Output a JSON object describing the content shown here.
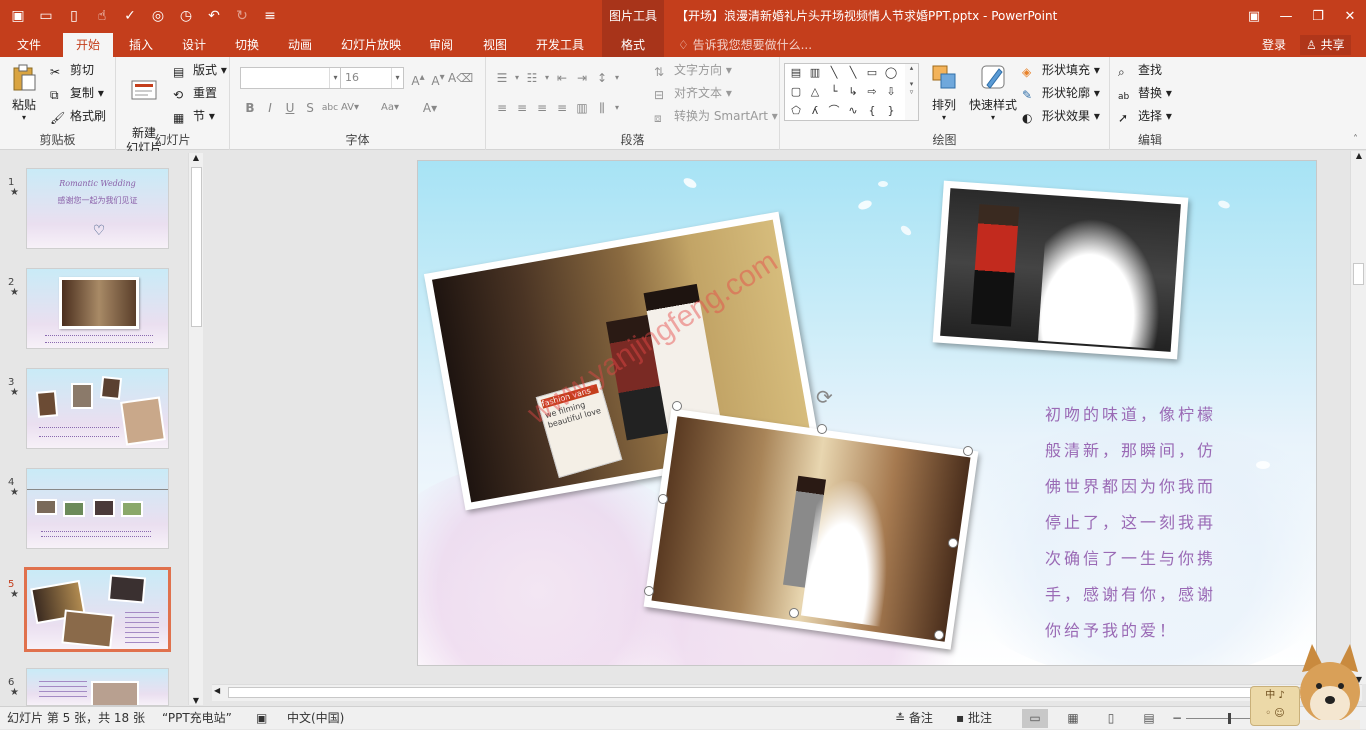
{
  "title_bar": {
    "context_group": "图片工具",
    "document_title": "【开场】浪漫清新婚礼片头开场视频情人节求婚PPT.pptx - PowerPoint"
  },
  "tabs": [
    {
      "label": "文件"
    },
    {
      "label": "开始"
    },
    {
      "label": "插入"
    },
    {
      "label": "设计"
    },
    {
      "label": "切换"
    },
    {
      "label": "动画"
    },
    {
      "label": "幻灯片放映"
    },
    {
      "label": "审阅"
    },
    {
      "label": "视图"
    },
    {
      "label": "开发工具"
    },
    {
      "label": "格式"
    }
  ],
  "tell_me": "告诉我您想要做什么...",
  "account": {
    "login": "登录",
    "share": "共享"
  },
  "ribbon": {
    "clipboard": {
      "label": "剪贴板",
      "paste": "粘贴",
      "cut": "剪切",
      "copy": "复制",
      "format_painter": "格式刷"
    },
    "slides": {
      "label": "幻灯片",
      "new_slide": "新建\n幻灯片",
      "layout": "版式",
      "reset": "重置",
      "section": "节"
    },
    "font": {
      "label": "字体",
      "size": "16"
    },
    "paragraph": {
      "label": "段落",
      "text_direction": "文字方向",
      "align_text": "对齐文本",
      "smartart": "转换为 SmartArt"
    },
    "drawing": {
      "label": "绘图",
      "arrange": "排列",
      "quick_styles": "快速样式",
      "shape_fill": "形状填充",
      "shape_outline": "形状轮廓",
      "shape_effects": "形状效果"
    },
    "editing": {
      "label": "编辑",
      "find": "查找",
      "replace": "替换",
      "select": "选择"
    }
  },
  "thumbnails": [
    {
      "num": "1",
      "title": "Romantic Wedding",
      "text": "感谢您一起为我们见证"
    },
    {
      "num": "2"
    },
    {
      "num": "3"
    },
    {
      "num": "4"
    },
    {
      "num": "5",
      "selected": true
    },
    {
      "num": "6"
    }
  ],
  "slide": {
    "poem": "初吻的味道，像柠檬般清新，那瞬间，仿佛世界都因为你我而停止了，这一刻我再次确信了一生与你携手，感谢有你，感谢你给予我的爱！",
    "watermark": "www.yanjingfeng.com",
    "photo_sign_1": "fashion vans",
    "photo_sign_2": "we filming beautiful love"
  },
  "status": {
    "slide_info": "幻灯片 第 5 张，共 18 张",
    "theme": "“PPT充电站”",
    "language": "中文(中国)",
    "notes": "备注",
    "comments": "批注"
  },
  "ime": {
    "line1": "中 ♪",
    "line2": "◦ ☺"
  },
  "colors": {
    "accent": "#c43e1c",
    "poem": "#9a6ab5",
    "selected_thumb": "#e0714d"
  }
}
